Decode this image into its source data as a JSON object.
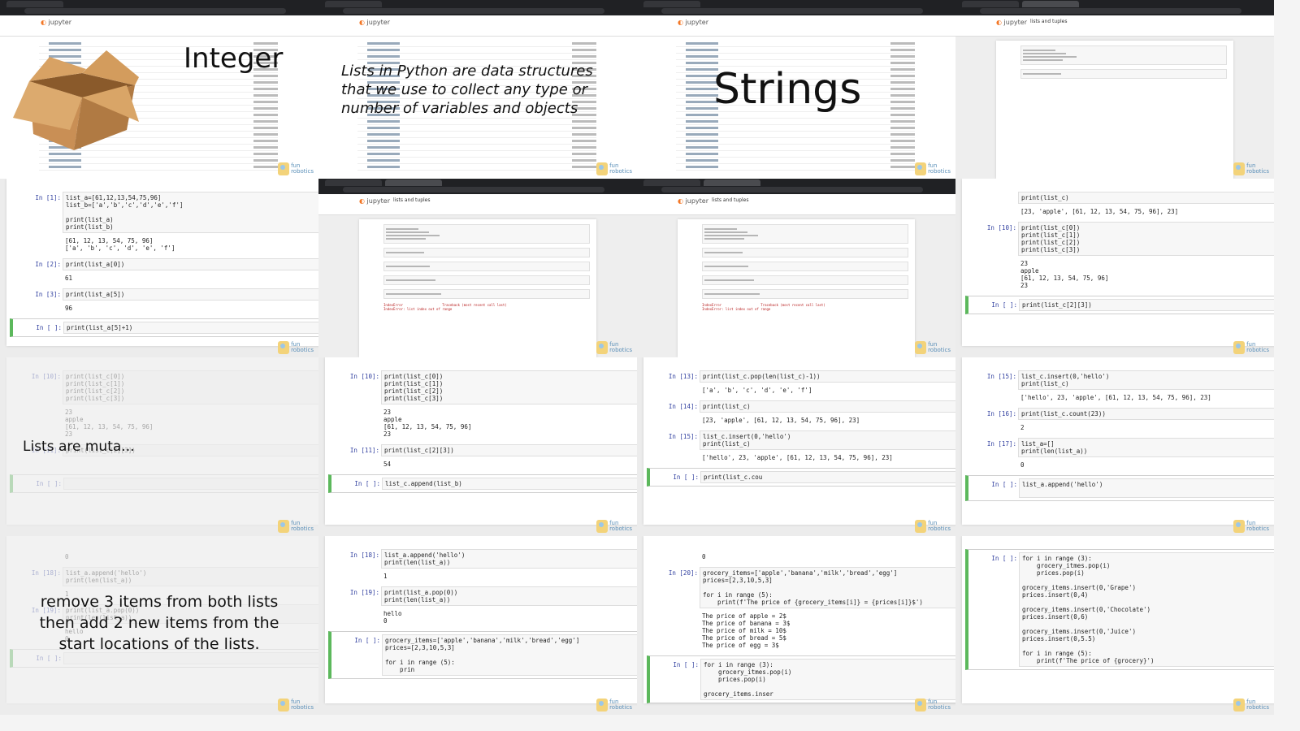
{
  "watermark": {
    "line1": "fun",
    "line2": "robotics"
  },
  "app": {
    "logo": "jupyter",
    "notebook_title": "lists and tuples"
  },
  "colors": {
    "active_cell_border": "#5cb85c",
    "prompt": "#303f9f",
    "chrome": "#202124",
    "jupyter_orange": "#f37726"
  },
  "thumbs": [
    {
      "type": "files",
      "overlay": "Integer",
      "icon": "cardboard-box-icon"
    },
    {
      "type": "files",
      "overlay": "Lists in Python are data structures that we use to collect any type or number of variables and objects"
    },
    {
      "type": "files",
      "overlay": "Strings"
    },
    {
      "type": "mini",
      "minicells": 2
    },
    {
      "type": "notebook",
      "cells": [
        {
          "prompt": "In [1]:",
          "code": [
            "list_a=[61,12,13,54,75,96]",
            "list_b=['a','b','c','d','e','f']",
            "",
            "print(list_a)",
            "print(list_b)"
          ],
          "output": [
            "[61, 12, 13, 54, 75, 96]",
            "['a', 'b', 'c', 'd', 'e', 'f']"
          ]
        },
        {
          "prompt": "In [2]:",
          "code": [
            "print(list_a[0])"
          ],
          "output": [
            "61"
          ]
        },
        {
          "prompt": "In [3]:",
          "code": [
            "print(list_a[5])"
          ],
          "output": [
            "96"
          ]
        },
        {
          "prompt": "In [ ]:",
          "code": [
            "print(list_a[5]+1)"
          ],
          "output": [],
          "active": true
        }
      ]
    },
    {
      "type": "mini",
      "minicells": 5,
      "error": [
        "IndexError                    Traceback (most recent call last)",
        "",
        "IndexError: list index out of range"
      ]
    },
    {
      "type": "mini",
      "minicells": 5,
      "error": [
        "IndexError                    Traceback (most recent call last)",
        "",
        "IndexError: list index out of range"
      ]
    },
    {
      "type": "notebook",
      "cells": [
        {
          "prompt": "",
          "code": [
            "print(list_c)"
          ],
          "output": [
            "[23, 'apple', [61, 12, 13, 54, 75, 96], 23]"
          ]
        },
        {
          "prompt": "In [10]:",
          "code": [
            "print(list_c[0])",
            "print(list_c[1])",
            "print(list_c[2])",
            "print(list_c[3])"
          ],
          "output": [
            "23",
            "apple",
            "[61, 12, 13, 54, 75, 96]",
            "23"
          ]
        },
        {
          "prompt": "In [ ]:",
          "code": [
            "print(list_c[2][3])"
          ],
          "output": [],
          "active": true
        }
      ]
    },
    {
      "type": "notebook",
      "faded": true,
      "overlay": "Lists are muta...",
      "cells": [
        {
          "prompt": "In [10]:",
          "code": [
            "print(list_c[0])",
            "print(list_c[1])",
            "print(list_c[2])",
            "print(list_c[3])"
          ],
          "output": [
            "23",
            "apple",
            "[61, 12, 13, 54, 75, 96]",
            "23"
          ]
        },
        {
          "prompt": "In [11]:",
          "code": [
            "print(list_c[2][3])"
          ],
          "output": [
            ""
          ]
        },
        {
          "prompt": "In [ ]:",
          "code": [
            ""
          ],
          "output": [],
          "active": true
        }
      ]
    },
    {
      "type": "notebook",
      "cells": [
        {
          "prompt": "In [10]:",
          "code": [
            "print(list_c[0])",
            "print(list_c[1])",
            "print(list_c[2])",
            "print(list_c[3])"
          ],
          "output": [
            "23",
            "apple",
            "[61, 12, 13, 54, 75, 96]",
            "23"
          ]
        },
        {
          "prompt": "In [11]:",
          "code": [
            "print(list_c[2][3])"
          ],
          "output": [
            "54"
          ]
        },
        {
          "prompt": "In [ ]:",
          "code": [
            "list_c.append(list_b)"
          ],
          "output": [],
          "active": true
        }
      ]
    },
    {
      "type": "notebook",
      "cells": [
        {
          "prompt": "In [13]:",
          "code": [
            "print(list_c.pop(len(list_c)-1))"
          ],
          "output": [
            "['a', 'b', 'c', 'd', 'e', 'f']"
          ]
        },
        {
          "prompt": "In [14]:",
          "code": [
            "print(list_c)"
          ],
          "output": [
            "[23, 'apple', [61, 12, 13, 54, 75, 96], 23]"
          ]
        },
        {
          "prompt": "In [15]:",
          "code": [
            "list_c.insert(0,'hello')",
            "print(list_c)"
          ],
          "output": [
            "['hello', 23, 'apple', [61, 12, 13, 54, 75, 96], 23]"
          ]
        },
        {
          "prompt": "In [ ]:",
          "code": [
            "print(list_c.cou"
          ],
          "output": [],
          "active": true
        }
      ]
    },
    {
      "type": "notebook",
      "cells": [
        {
          "prompt": "In [15]:",
          "code": [
            "list_c.insert(0,'hello')",
            "print(list_c)"
          ],
          "output": [
            "['hello', 23, 'apple', [61, 12, 13, 54, 75, 96], 23]"
          ]
        },
        {
          "prompt": "In [16]:",
          "code": [
            "print(list_c.count(23))"
          ],
          "output": [
            "2"
          ]
        },
        {
          "prompt": "In [17]:",
          "code": [
            "list_a=[]",
            "print(len(list_a))"
          ],
          "output": [
            "0"
          ]
        },
        {
          "prompt": "In [ ]:",
          "code": [
            "list_a.append('hello')",
            ""
          ],
          "output": [],
          "active": true
        }
      ]
    },
    {
      "type": "notebook",
      "faded": true,
      "overlay": "remove 3 items from both lists then add 2 new items from the start locations of the lists.",
      "cells": [
        {
          "prompt": "",
          "code": [],
          "output": [
            "0"
          ]
        },
        {
          "prompt": "In [18]:",
          "code": [
            "list_a.append('hello')",
            "print(len(list_a))"
          ],
          "output": [
            "1"
          ]
        },
        {
          "prompt": "In [19]:",
          "code": [
            "print(list_a.pop(0))",
            "print(len(list_a))"
          ],
          "output": [
            "hello",
            "0"
          ]
        },
        {
          "prompt": "In [ ]:",
          "code": [
            ""
          ],
          "output": [],
          "active": true
        }
      ]
    },
    {
      "type": "notebook",
      "cells": [
        {
          "prompt": "In [18]:",
          "code": [
            "list_a.append('hello')",
            "print(len(list_a))"
          ],
          "output": [
            "1"
          ]
        },
        {
          "prompt": "In [19]:",
          "code": [
            "print(list_a.pop(0))",
            "print(len(list_a))"
          ],
          "output": [
            "hello",
            "0"
          ]
        },
        {
          "prompt": "In [ ]:",
          "code": [
            "grocery_items=['apple','banana','milk','bread','egg']",
            "prices=[2,3,10,5,3]",
            "",
            "for i in range (5):",
            "    prin"
          ],
          "output": [],
          "active": true
        }
      ]
    },
    {
      "type": "notebook",
      "cells": [
        {
          "prompt": "",
          "code": [],
          "output": [
            "0"
          ]
        },
        {
          "prompt": "In [20]:",
          "code": [
            "grocery_items=['apple','banana','milk','bread','egg']",
            "prices=[2,3,10,5,3]",
            "",
            "for i in range (5):",
            "    print(f'The price of {grocery_items[i]} = {prices[i]}$')"
          ],
          "output": [
            "The price of apple = 2$",
            "The price of banana = 3$",
            "The price of milk = 10$",
            "The price of bread = 5$",
            "The price of egg = 3$"
          ]
        },
        {
          "prompt": "In [ ]:",
          "code": [
            "for i in range (3):",
            "    grocery_itmes.pop(i)",
            "    prices.pop(i)",
            "",
            "grocery_items.inser"
          ],
          "output": [],
          "active": true
        }
      ]
    },
    {
      "type": "notebook",
      "cells": [
        {
          "prompt": "In [ ]:",
          "code": [
            "for i in range (3):",
            "    grocery_itmes.pop(i)",
            "    prices.pop(i)",
            "",
            "grocery_items.insert(0,'Grape')",
            "prices.insert(0,4)",
            "",
            "grocery_items.insert(0,'Chocolate')",
            "prices.insert(0,6)",
            "",
            "grocery_items.insert(0,'Juice')",
            "prices.insert(0,5.5)",
            "",
            "for i in range (5):",
            "    print(f'The price of {grocery}')"
          ],
          "output": [],
          "active": true
        }
      ]
    }
  ]
}
